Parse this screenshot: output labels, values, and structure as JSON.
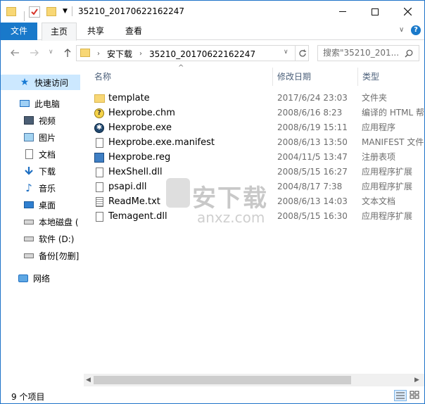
{
  "window": {
    "title": "35210_20170622162247",
    "minimize_icon": "minimize-icon",
    "maximize_icon": "maximize-icon",
    "close_icon": "close-icon"
  },
  "ribbon": {
    "tabs": [
      {
        "label": "文件"
      },
      {
        "label": "主页"
      },
      {
        "label": "共享"
      },
      {
        "label": "查看"
      }
    ]
  },
  "address": {
    "crumbs": [
      "安下载",
      "35210_20170622162247"
    ],
    "search_placeholder": "搜索\"35210_201...",
    "search_icon": "search-icon"
  },
  "nav": {
    "items": [
      {
        "label": "快速访问",
        "icon": "star-icon"
      },
      {
        "label": "此电脑",
        "icon": "computer-icon"
      },
      {
        "label": "视频",
        "icon": "video-icon"
      },
      {
        "label": "图片",
        "icon": "picture-icon"
      },
      {
        "label": "文档",
        "icon": "document-icon"
      },
      {
        "label": "下载",
        "icon": "download-icon"
      },
      {
        "label": "音乐",
        "icon": "music-icon"
      },
      {
        "label": "桌面",
        "icon": "desktop-icon"
      },
      {
        "label": "本地磁盘 (",
        "icon": "drive-icon"
      },
      {
        "label": "软件 (D:)",
        "icon": "drive-icon"
      },
      {
        "label": "备份[勿删]",
        "icon": "drive-icon"
      },
      {
        "label": "网络",
        "icon": "network-icon"
      }
    ]
  },
  "columns": {
    "name": "名称",
    "date": "修改日期",
    "type": "类型"
  },
  "files": [
    {
      "name": "template",
      "date": "2017/6/24 23:03",
      "type": "文件夹",
      "icon": "folder-icon"
    },
    {
      "name": "Hexprobe.chm",
      "date": "2008/6/16 8:23",
      "type": "编译的 HTML 帮",
      "icon": "help-file-icon"
    },
    {
      "name": "Hexprobe.exe",
      "date": "2008/6/19 15:11",
      "type": "应用程序",
      "icon": "exe-icon"
    },
    {
      "name": "Hexprobe.exe.manifest",
      "date": "2008/6/13 13:50",
      "type": "MANIFEST 文件",
      "icon": "file-icon"
    },
    {
      "name": "Hexprobe.reg",
      "date": "2004/11/5 13:47",
      "type": "注册表项",
      "icon": "registry-icon"
    },
    {
      "name": "HexShell.dll",
      "date": "2008/5/15 16:27",
      "type": "应用程序扩展",
      "icon": "dll-icon"
    },
    {
      "name": "psapi.dll",
      "date": "2004/8/17 7:38",
      "type": "应用程序扩展",
      "icon": "dll-icon"
    },
    {
      "name": "ReadMe.txt",
      "date": "2008/6/13 14:03",
      "type": "文本文档",
      "icon": "text-file-icon"
    },
    {
      "name": "Temagent.dll",
      "date": "2008/5/15 16:30",
      "type": "应用程序扩展",
      "icon": "dll-icon"
    }
  ],
  "watermark": {
    "text": "安下载",
    "sub": "anxz.com"
  },
  "status": {
    "count": "9 个项目"
  },
  "colors": {
    "accent": "#1979ca",
    "selection": "#cce8ff",
    "header_text": "#4c607a",
    "folder": "#f8d775"
  }
}
